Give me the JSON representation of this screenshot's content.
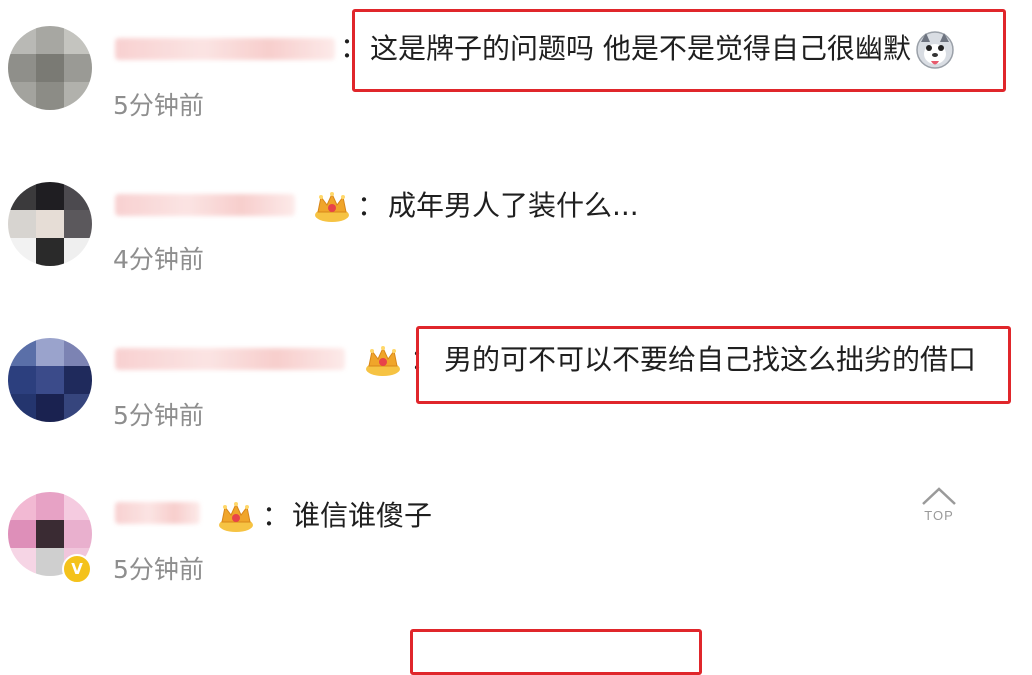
{
  "comments": [
    {
      "text": "这是牌子的问题吗 他是不是觉得自己很幽默",
      "time": "5分钟前",
      "has_crown": false,
      "emoji": "husky-dog-emoji",
      "highlighted": true
    },
    {
      "text": "成年男人了装什么...",
      "time": "4分钟前",
      "has_crown": true,
      "highlighted": false
    },
    {
      "text": "男的可不可以不要给自己找这么拙劣的借口",
      "time": "5分钟前",
      "has_crown": true,
      "highlighted": true
    },
    {
      "text": "谁信谁傻子",
      "time": "5分钟前",
      "has_crown": true,
      "verified": true,
      "highlighted": false
    }
  ],
  "separator": "：",
  "verified_mark": "V",
  "top_button": {
    "label": "TOP",
    "icon": "chevron-up-icon"
  },
  "colors": {
    "highlight_border": "#e0262b",
    "time_text": "#8e8e8e",
    "crown_gold": "#f0b429",
    "verified_badge": "#f4c21b"
  }
}
